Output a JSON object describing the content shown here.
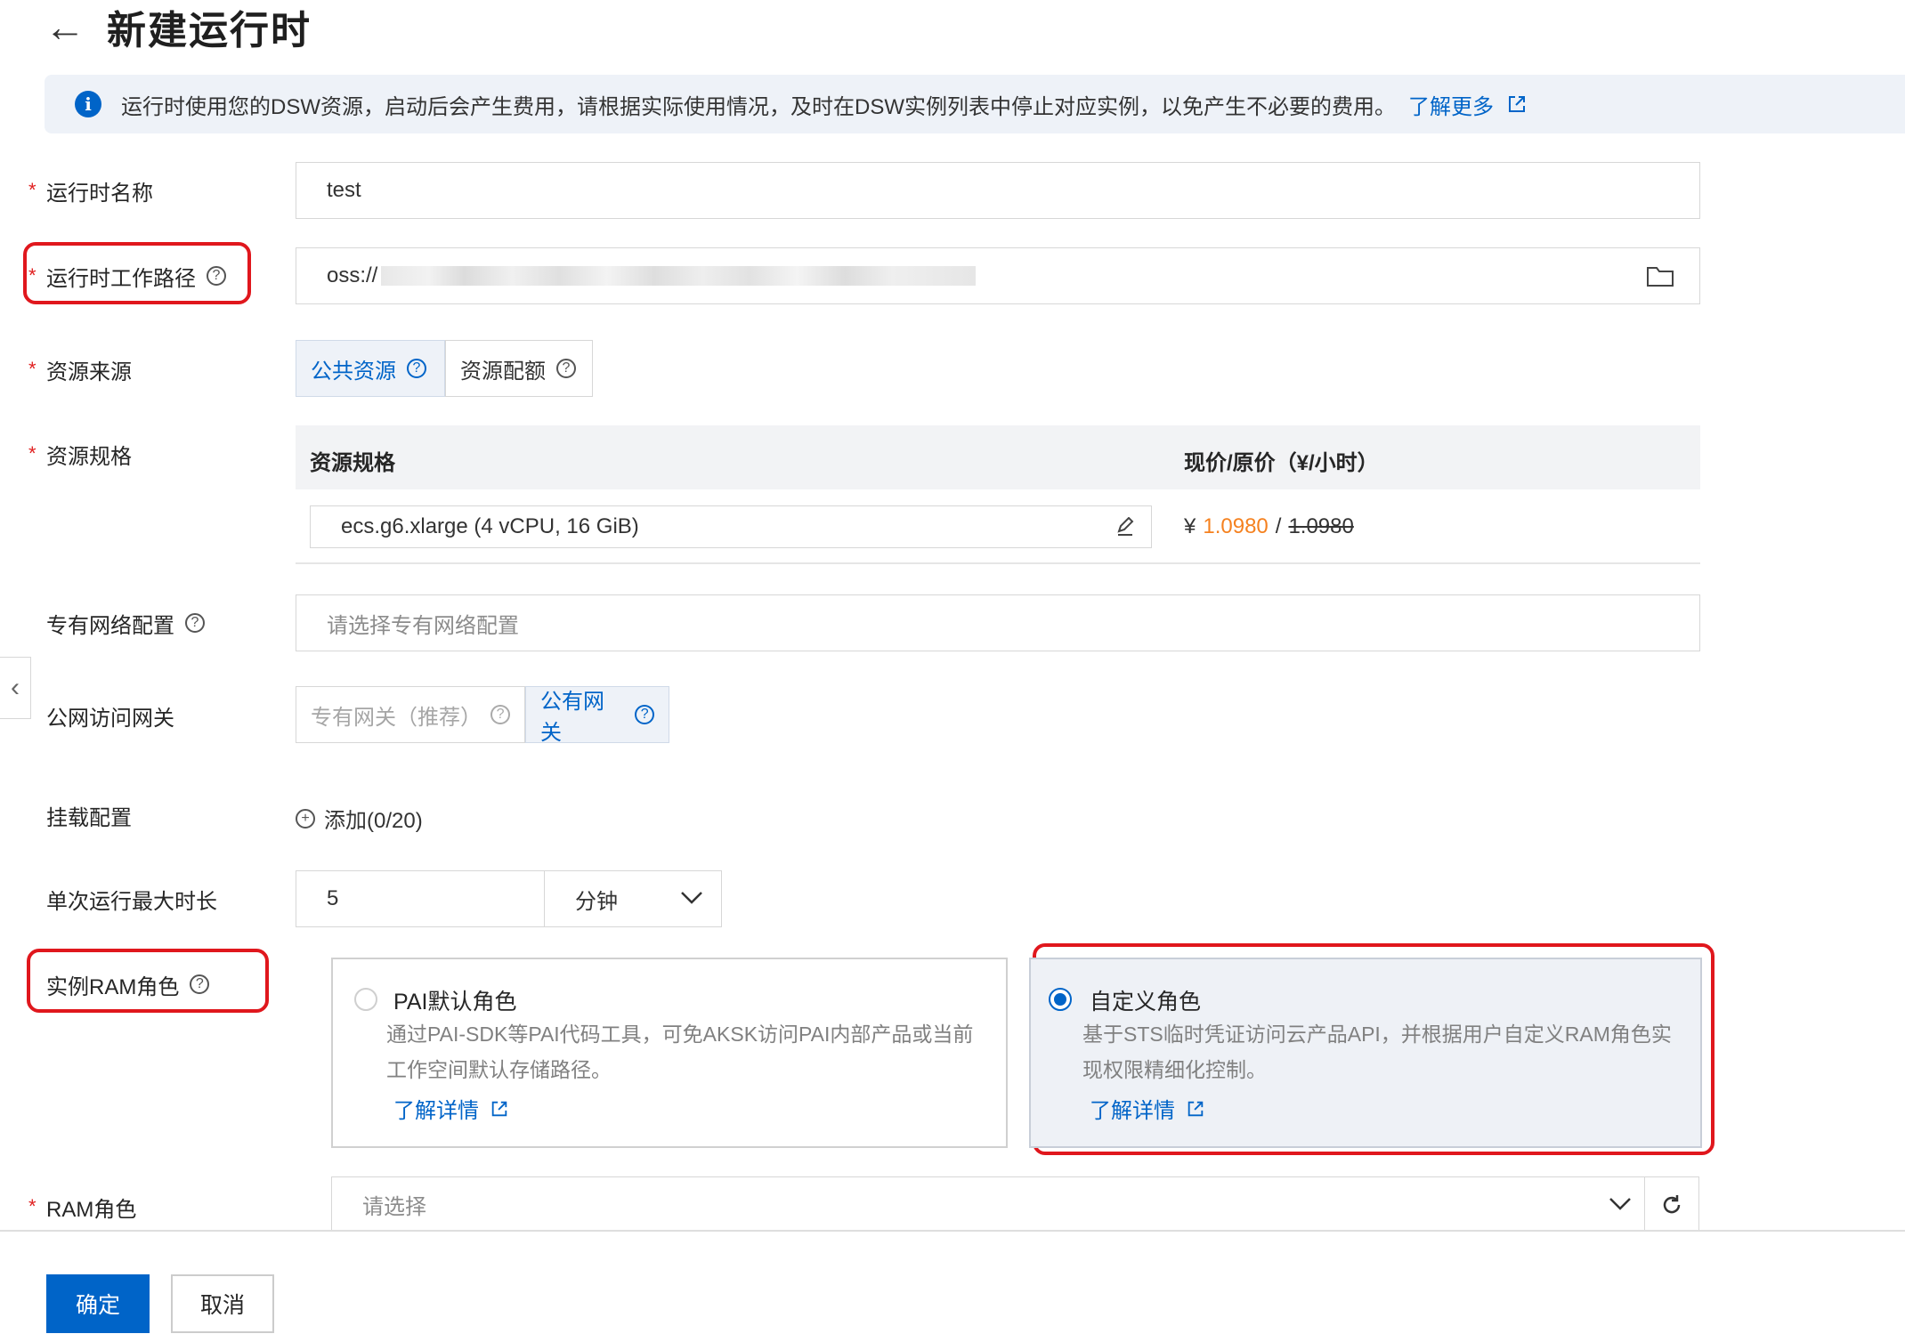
{
  "header": {
    "back_icon": "arrow-left-icon",
    "title": "新建运行时"
  },
  "notice": {
    "text": "运行时使用您的DSW资源，启动后会产生费用，请根据实际使用情况，及时在DSW实例列表中停止对应实例，以免产生不必要的费用。",
    "link": "了解更多"
  },
  "form": {
    "name": {
      "label": "运行时名称",
      "value": "test"
    },
    "workdir": {
      "label": "运行时工作路径",
      "value": "oss://"
    },
    "source": {
      "label": "资源来源",
      "options": [
        "公共资源",
        "资源配额"
      ],
      "selected": "公共资源"
    },
    "spec": {
      "label": "资源规格",
      "col_spec": "资源规格",
      "col_price": "现价/原价（¥/小时）",
      "value": "ecs.g6.xlarge  (4 vCPU, 16 GiB)",
      "currency": "¥",
      "price_now": "1.0980",
      "price_sep": "/",
      "price_orig": "1.0980"
    },
    "vpc": {
      "label": "专有网络配置",
      "placeholder": "请选择专有网络配置"
    },
    "gateway": {
      "label": "公网访问网关",
      "options": [
        "专有网关（推荐）",
        "公有网关"
      ],
      "selected": "公有网关"
    },
    "mount": {
      "label": "挂载配置",
      "add": "添加(0/20)"
    },
    "duration": {
      "label": "单次运行最大时长",
      "value": "5",
      "unit": "分钟"
    },
    "ram_role_type": {
      "label": "实例RAM角色",
      "options": [
        {
          "title": "PAI默认角色",
          "desc": "通过PAI-SDK等PAI代码工具，可免AKSK访问PAI内部产品或当前工作空间默认存储路径。",
          "link": "了解详情",
          "selected": false
        },
        {
          "title": "自定义角色",
          "desc": "基于STS临时凭证访问云产品API，并根据用户自定义RAM角色实现权限精细化控制。",
          "link": "了解详情",
          "selected": true
        }
      ]
    },
    "ram_role": {
      "label": "RAM角色",
      "placeholder": "请选择"
    }
  },
  "footer": {
    "confirm": "确定",
    "cancel": "取消"
  },
  "colors": {
    "primary": "#0064c8",
    "required": "#e02020",
    "price": "#f5811f",
    "highlight": "#e0171d"
  }
}
